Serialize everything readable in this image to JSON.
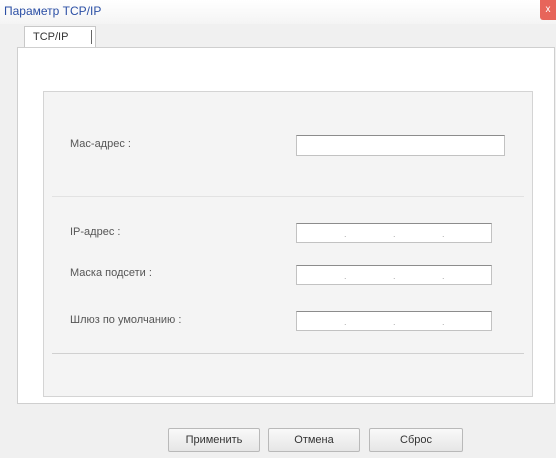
{
  "window": {
    "title": "Параметр TCP/IP",
    "close_label": "x"
  },
  "tabs": [
    {
      "label": "TCP/IP"
    }
  ],
  "fields": {
    "mac_label": "Мас-адрес :",
    "ip_label": "IP-адрес :",
    "mask_label": "Маска подсети :",
    "gateway_label": "Шлюз по умолчанию :",
    "dot": "."
  },
  "buttons": {
    "apply": "Применить",
    "cancel": "Отмена",
    "reset": "Сброс"
  }
}
